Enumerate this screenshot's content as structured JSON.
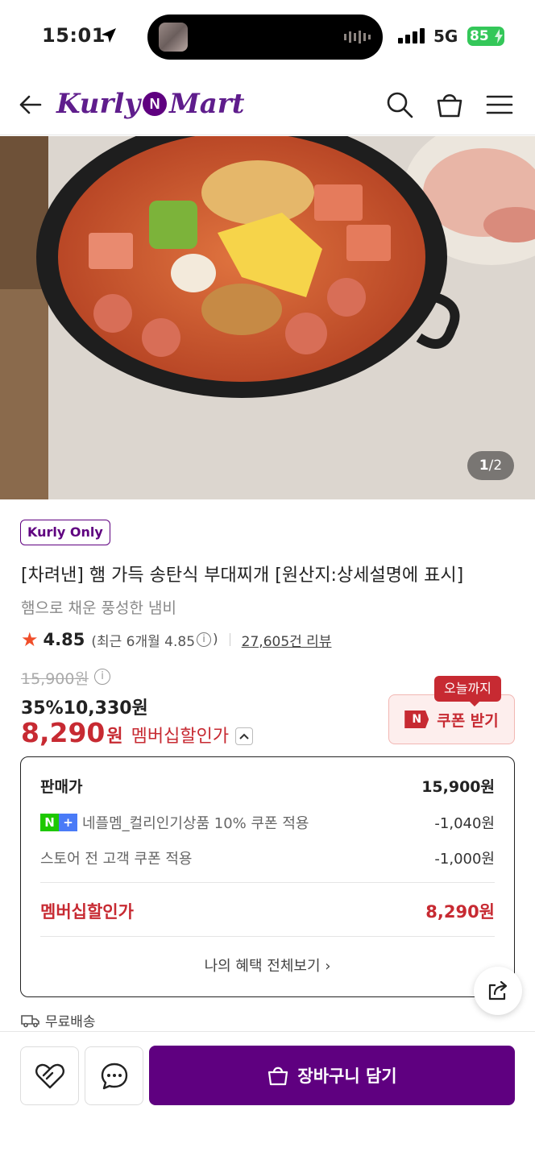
{
  "status_bar": {
    "time": "15:01",
    "network": "5G",
    "battery": "85"
  },
  "header": {
    "logo_left": "Kurly",
    "logo_badge": "N",
    "logo_right": "Mart"
  },
  "hero": {
    "counter_current": "1",
    "counter_total": "/2"
  },
  "product": {
    "badge": "Kurly Only",
    "title": "[차려낸] 햄 가득 송탄식 부대찌개 [원산지:상세설명에 표시]",
    "subtitle": "햄으로 채운 풍성한 냄비",
    "rating": {
      "score": "4.85",
      "recent_prefix": "(최근 6개월 4.85",
      "recent_suffix": ")",
      "reviews": "27,605건 리뷰"
    },
    "original_price": "15,900원",
    "discount_line": "35%10,330원",
    "member_price": "8,290",
    "member_won": "원",
    "member_label": "멤버십할인가",
    "coupon_tag": "오늘까지",
    "coupon_badge": "N",
    "coupon_label": "쿠폰 받기"
  },
  "price_box": {
    "sale_label": "판매가",
    "sale_value": "15,900원",
    "coupon1_label": "네플멤_컬리인기상품 10% 쿠폰 적용",
    "coupon1_value": "-1,040원",
    "coupon2_label": "스토어 전 고객 쿠폰 적용",
    "coupon2_value": "-1,000원",
    "member_label": "멤버십할인가",
    "member_value": "8,290원",
    "benefits_link": "나의 혜택 전체보기 ›"
  },
  "delivery": {
    "label": "무료배송"
  },
  "bottom": {
    "cart_label": "장바구니 담기"
  },
  "colors": {
    "brand": "#5f0080",
    "sale_red": "#c72a32",
    "star": "#f04e2a",
    "np_green": "#1ec800",
    "np_blue": "#4a7bf7"
  },
  "icons": [
    "location-arrow-icon",
    "signal-icon",
    "back-arrow-icon",
    "search-icon",
    "cart-bag-icon",
    "menu-icon",
    "info-icon",
    "star-icon",
    "share-icon",
    "truck-icon",
    "heart-icon",
    "chat-icon"
  ]
}
